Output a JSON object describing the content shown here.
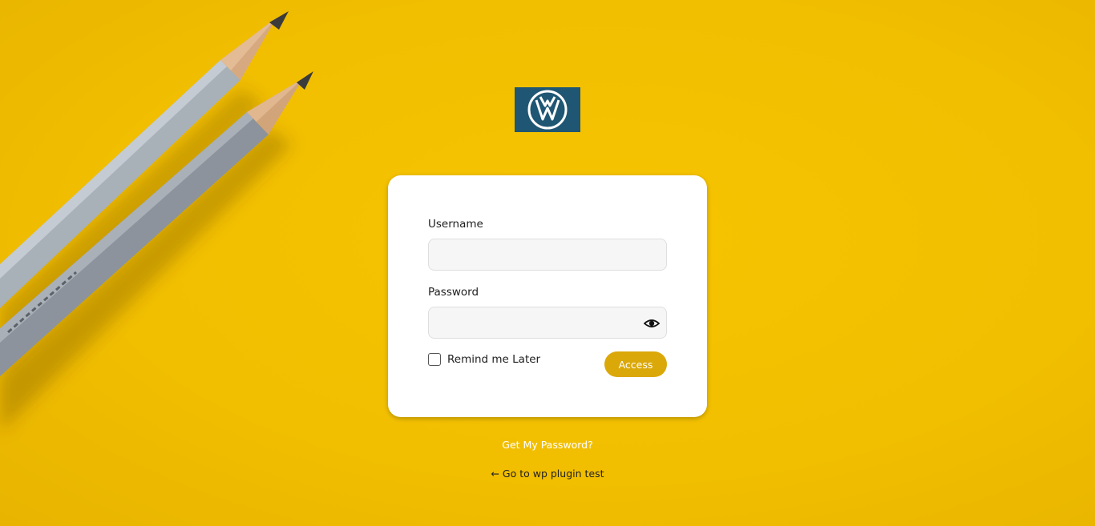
{
  "brand": {
    "logo_icon": "vw-logo-icon",
    "logo_bg_color": "#1f5673",
    "background_color": "#f5c300",
    "accent_color": "#dba80a"
  },
  "form": {
    "username_label": "Username",
    "username_value": "",
    "password_label": "Password",
    "password_value": "",
    "show_password_icon": "eye-icon",
    "remember_label": "Remind me Later",
    "remember_checked": false,
    "submit_label": "Access"
  },
  "links": {
    "forgot_password": "Get My Password?",
    "back_to_site": "← Go to wp plugin test"
  }
}
